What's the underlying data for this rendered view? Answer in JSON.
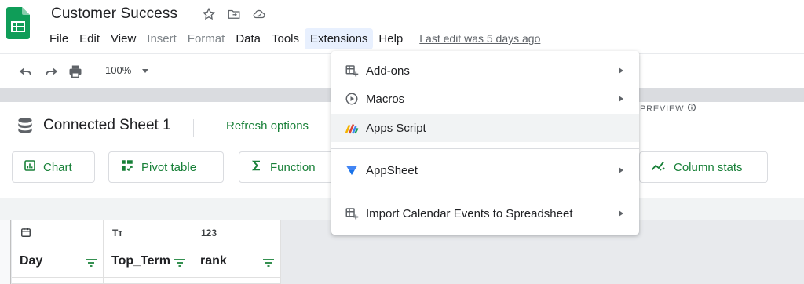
{
  "app": {
    "title": "Customer Success",
    "last_edit": "Last edit was 5 days ago"
  },
  "menubar": {
    "items": [
      {
        "label": "File",
        "state": "enabled"
      },
      {
        "label": "Edit",
        "state": "enabled"
      },
      {
        "label": "View",
        "state": "enabled"
      },
      {
        "label": "Insert",
        "state": "disabled"
      },
      {
        "label": "Format",
        "state": "disabled"
      },
      {
        "label": "Data",
        "state": "enabled"
      },
      {
        "label": "Tools",
        "state": "enabled"
      },
      {
        "label": "Extensions",
        "state": "active"
      },
      {
        "label": "Help",
        "state": "enabled"
      }
    ]
  },
  "toolbar": {
    "zoom": "100%",
    "icons": [
      "undo-icon",
      "redo-icon",
      "print-icon"
    ]
  },
  "connected_sheet": {
    "title": "Connected Sheet 1",
    "refresh_label": "Refresh options",
    "buttons": [
      {
        "label": "Chart",
        "icon": "chart-icon"
      },
      {
        "label": "Pivot table",
        "icon": "pivot-icon"
      },
      {
        "label": "Function",
        "icon": "sigma-icon"
      },
      {
        "label": "Column stats",
        "icon": "stats-icon"
      }
    ],
    "preview_label": "PREVIEW"
  },
  "grid": {
    "columns": [
      {
        "name": "Day",
        "type_icon": "calendar-icon"
      },
      {
        "name": "Top_Term",
        "type_icon": "Tт"
      },
      {
        "name": "rank",
        "type_icon": "123"
      }
    ]
  },
  "extensions_menu": {
    "items": [
      {
        "label": "Add-ons",
        "icon": "addons-icon",
        "submenu": true
      },
      {
        "label": "Macros",
        "icon": "play-icon",
        "submenu": true
      },
      {
        "label": "Apps Script",
        "icon": "apps-script-icon",
        "submenu": false,
        "highlighted": true
      },
      {
        "label": "AppSheet",
        "icon": "appsheet-icon",
        "submenu": true
      },
      {
        "label": "Import Calendar Events to Spreadsheet",
        "icon": "addon-app-icon",
        "submenu": true
      }
    ]
  },
  "colors": {
    "accent_green": "#188038",
    "menu_active": "#e8f0fe",
    "sheets_green": "#0f9d58"
  }
}
